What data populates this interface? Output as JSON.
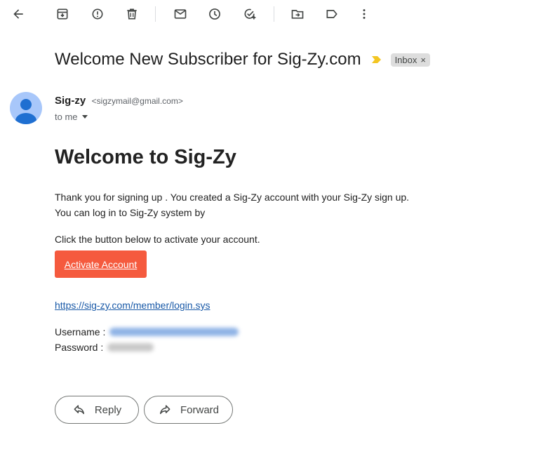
{
  "toolbar": {
    "icons": [
      "back-arrow-icon",
      "archive-icon",
      "report-spam-icon",
      "delete-icon",
      "mark-unread-icon",
      "snooze-icon",
      "add-to-tasks-icon",
      "move-to-icon",
      "labels-icon",
      "more-options-icon"
    ]
  },
  "email": {
    "subject": "Welcome New Subscriber for Sig-Zy.com",
    "label": "Inbox",
    "label_close": "×",
    "importance_color": "#f3c623",
    "sender_name": "Sig-zy",
    "sender_email": "<sigzymail@gmail.com>",
    "to": "to me",
    "heading": "Welcome to Sig-Zy",
    "paragraph_line1": "Thank you for signing up . You created a Sig-Zy account with your Sig-Zy sign up.",
    "paragraph_line2": "You can log in to Sig-Zy system by",
    "instruction": "Click the button below to activate your account.",
    "activate_label": "Activate Account",
    "activate_color": "#f55a3e",
    "login_link": "https://sig-zy.com/member/login.sys",
    "username_label": "Username :",
    "password_label": "Password :"
  },
  "actions": {
    "reply_label": "Reply",
    "forward_label": "Forward"
  }
}
